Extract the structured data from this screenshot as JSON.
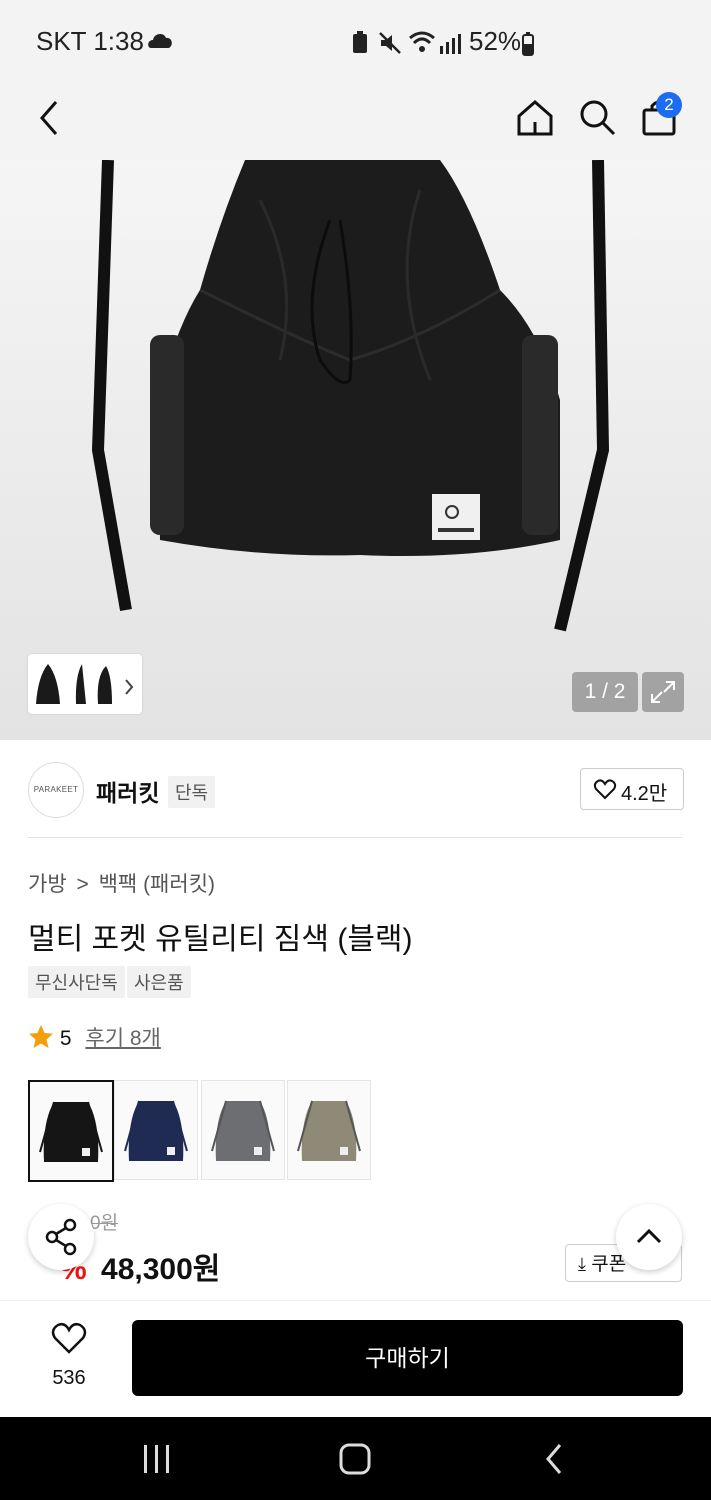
{
  "status_bar": {
    "carrier_time": "SKT 1:38",
    "battery": "52%"
  },
  "nav": {
    "cart_count": "2"
  },
  "gallery": {
    "counter": "1 / 2"
  },
  "brand": {
    "logo_text": "PARAKEET",
    "name": "패러킷",
    "exclusive_tag": "단독",
    "likes": "4.2만"
  },
  "breadcrumb": {
    "category": "가방",
    "separator": ">",
    "subcategory": "백팩 (패러킷)"
  },
  "product": {
    "title": "멀티 포켓 유틸리티 짐색 (블랙)",
    "tags": [
      "무신사단독",
      "사은품"
    ],
    "rating": "5",
    "reviews": "후기 8개",
    "colors": [
      "black",
      "navy",
      "gray",
      "beige"
    ],
    "original_price_partial": "0원",
    "discount_partial": "%",
    "sale_price": "48,300원",
    "coupon_label": "쿠폰"
  },
  "bottom_bar": {
    "wishlist_count": "536",
    "buy_label": "구매하기"
  },
  "colors": {
    "swatch_black": "#151515",
    "swatch_navy": "#1f2b52",
    "swatch_gray": "#6c6e72",
    "swatch_beige": "#8f8a78",
    "discount_red": "#f31110",
    "badge_blue": "#1d6cf0"
  }
}
